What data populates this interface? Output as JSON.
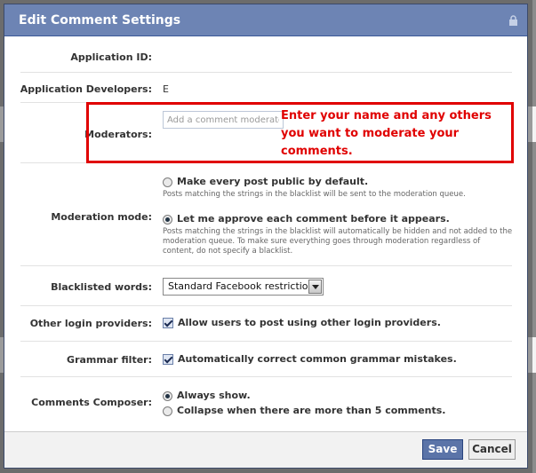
{
  "dialog": {
    "title": "Edit Comment Settings"
  },
  "fields": {
    "application_id": {
      "label": "Application ID:"
    },
    "app_developers": {
      "label": "Application Developers:",
      "value": "E"
    },
    "moderators": {
      "label": "Moderators:",
      "placeholder": "Add a comment moderator"
    },
    "moderation_mode": {
      "label": "Moderation mode:",
      "options": [
        {
          "label": "Make every post public by default.",
          "hint": "Posts matching the strings in the blacklist will be sent to the moderation queue.",
          "selected": false
        },
        {
          "label": "Let me approve each comment before it appears.",
          "hint": "Posts matching the strings in the blacklist will automatically be hidden and not added to the moderation queue. To make sure everything goes through moderation regardless of content, do not specify a blacklist.",
          "selected": true
        }
      ]
    },
    "blacklisted_words": {
      "label": "Blacklisted words:",
      "selected": "Standard Facebook restrictions"
    },
    "login_providers": {
      "label": "Other login providers:",
      "option": "Allow users to post using other login providers.",
      "checked": true
    },
    "grammar_filter": {
      "label": "Grammar filter:",
      "option": "Automatically correct common grammar mistakes.",
      "checked": true
    },
    "comments_composer": {
      "label": "Comments Composer:",
      "options": [
        {
          "label": "Always show.",
          "selected": true
        },
        {
          "label": "Collapse when there are more than 5 comments.",
          "selected": false
        }
      ]
    }
  },
  "annotation": {
    "text": "Enter your name and any others you want to moderate your comments."
  },
  "buttons": {
    "save": "Save",
    "cancel": "Cancel"
  },
  "colors": {
    "title_bar": "#6d84b4",
    "annotation": "#e00000",
    "save_button": "#5b74a8"
  }
}
